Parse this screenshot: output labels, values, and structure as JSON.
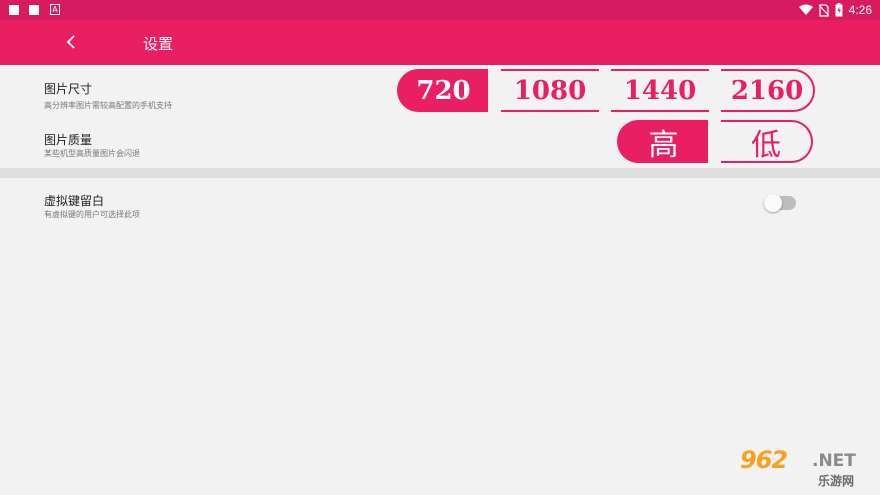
{
  "status_bar": {
    "time": "4:26",
    "icons": [
      "notification-square-icon",
      "notification-square-icon",
      "a-icon",
      "wifi-icon",
      "no-sim-icon",
      "battery-icon"
    ],
    "a_glyph": "A",
    "color": "#d81b60"
  },
  "app_bar": {
    "title": "设置",
    "back_icon": "chevron-left-icon",
    "color": "#e91e63"
  },
  "settings": {
    "image_size": {
      "title": "图片尺寸",
      "description": "高分辨率图片需较高配置的手机支持",
      "options": [
        "720",
        "1080",
        "1440",
        "2160"
      ],
      "selected": "720"
    },
    "image_quality": {
      "title": "图片质量",
      "description": "某些机型高质量图片会闪退",
      "options": [
        "高",
        "低"
      ],
      "selected": "高"
    },
    "virtual_keys": {
      "title": "虚拟键留白",
      "description": "有虚拟键的用户可选择此项",
      "enabled": false
    }
  },
  "watermark": {
    "brand": "962",
    "domain": ".NET",
    "subtitle": "乐游网"
  }
}
